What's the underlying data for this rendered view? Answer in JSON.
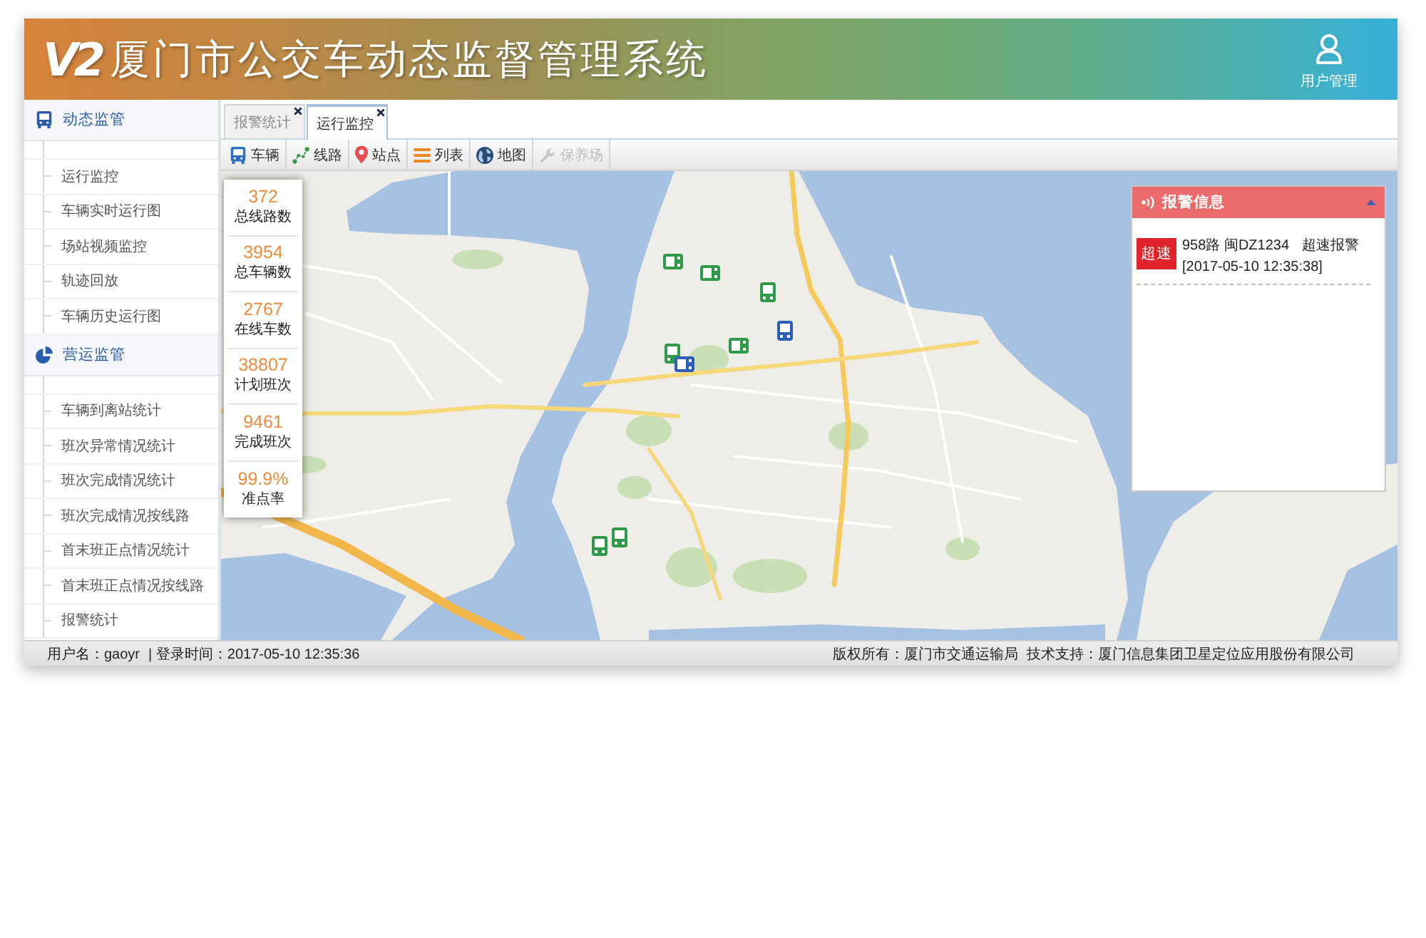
{
  "header": {
    "logo": "V2",
    "title": "厦门市公交车动态监督管理系统",
    "user_menu": "用户管理"
  },
  "sidebar": {
    "sections": [
      {
        "title": "动态监管",
        "items": [
          {
            "label": "运行监控",
            "selected": false
          },
          {
            "label": "车辆实时运行图",
            "selected": false
          },
          {
            "label": "场站视频监控",
            "selected": false
          },
          {
            "label": "轨迹回放",
            "selected": false
          },
          {
            "label": "车辆历史运行图",
            "selected": false
          }
        ]
      },
      {
        "title": "营运监管",
        "items": [
          {
            "label": "车辆到离站统计",
            "selected": false
          },
          {
            "label": "班次异常情况统计",
            "selected": false
          },
          {
            "label": "班次完成情况统计",
            "selected": false
          },
          {
            "label": "班次完成情况按线路",
            "selected": false
          },
          {
            "label": "首末班正点情况统计",
            "selected": false
          },
          {
            "label": "首末班正点情况按线路",
            "selected": false
          },
          {
            "label": "报警统计",
            "selected": false
          }
        ]
      }
    ]
  },
  "tabs": [
    {
      "label": "报警统计",
      "selected": false
    },
    {
      "label": "运行监控",
      "selected": true
    }
  ],
  "toolbar": [
    {
      "label": "车辆",
      "disabled": false
    },
    {
      "label": "线路",
      "disabled": false
    },
    {
      "label": "站点",
      "disabled": false
    },
    {
      "label": "列表",
      "disabled": false
    },
    {
      "label": "地图",
      "disabled": false
    },
    {
      "label": "保养场",
      "disabled": true
    }
  ],
  "stats": [
    {
      "value": "372",
      "label": "总线路数"
    },
    {
      "value": "3954",
      "label": "总车辆数"
    },
    {
      "value": "2767",
      "label": "在线车数"
    },
    {
      "value": "38807",
      "label": "计划班次"
    },
    {
      "value": "9461",
      "label": "完成班次"
    },
    {
      "value": "99.9%",
      "label": "准点率"
    }
  ],
  "alarm_panel": {
    "title": "报警信息",
    "alarms": [
      {
        "badge": "超速",
        "vehicle": "958路 闽DZ1234",
        "type": "超速报警",
        "time": "[2017-05-10 12:35:38]"
      }
    ]
  },
  "status_bar": {
    "user": "用户名：gaoyr",
    "login_time": "| 登录时间：2017-05-10 12:35:36",
    "copyright": "版权所有：厦门市交通运输局",
    "support": "技术支持：厦门信息集团卫星定位应用股份有限公司"
  }
}
